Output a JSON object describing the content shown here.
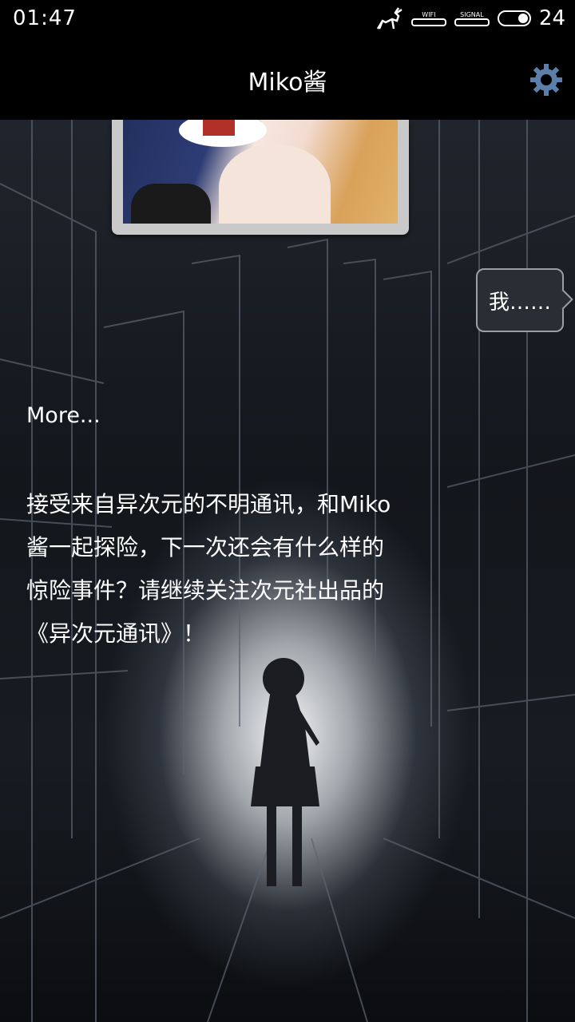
{
  "status_bar": {
    "time": "01:47",
    "wifi_label": "WIFI",
    "signal_label": "SIGNAL",
    "battery": "24"
  },
  "header": {
    "title": "Miko酱"
  },
  "chat": {
    "user_bubble": "我……",
    "more_label": "More...",
    "story_text": "接受来自异次元的不明通讯，和Miko\n酱一起探险，下一次还会有什么样的\n惊险事件？请继续关注次元社出品的\n《异次元通讯》！"
  },
  "colors": {
    "accent_gear": "#5b7fa8",
    "bubble_bg": "#2a2d33"
  }
}
